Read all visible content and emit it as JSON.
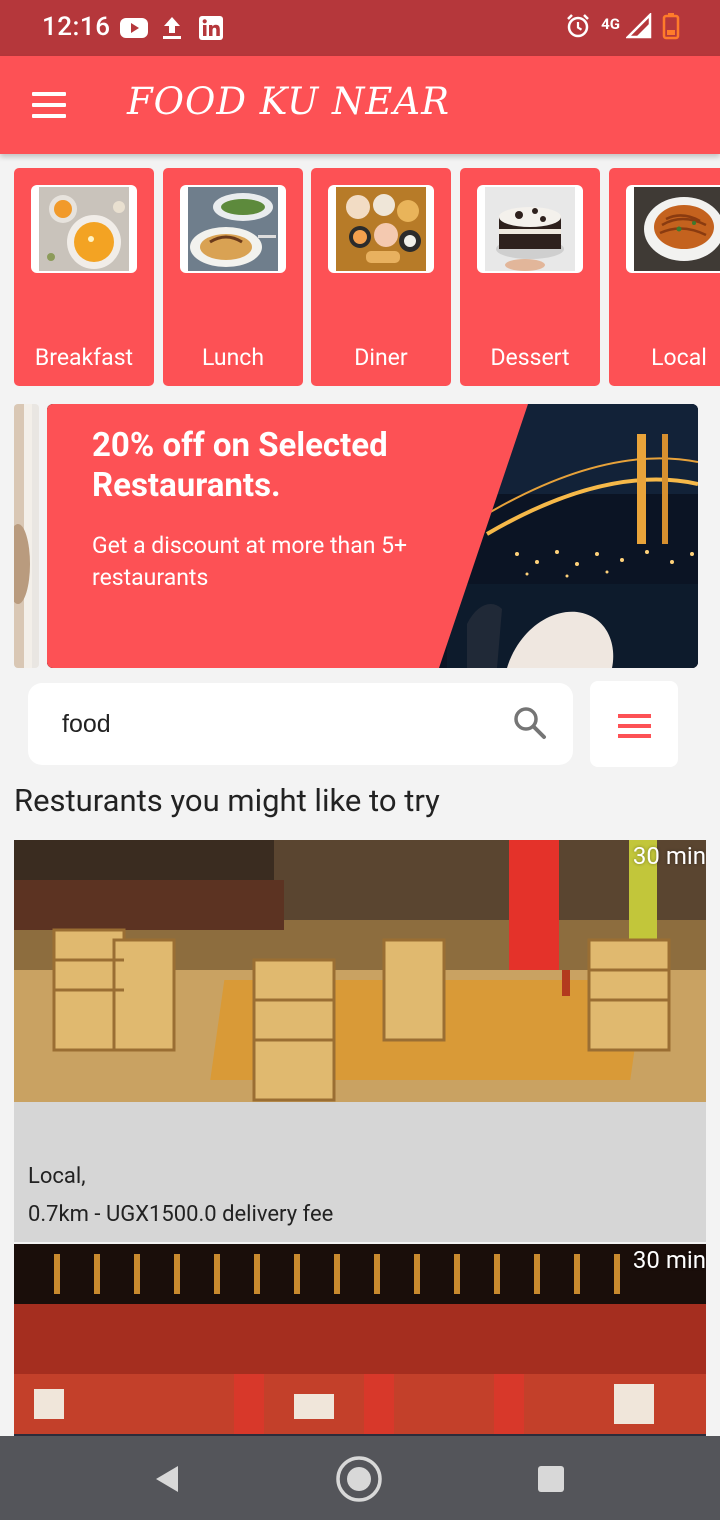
{
  "status_bar": {
    "time": "12:16",
    "network": "4G",
    "icons": [
      "youtube-icon",
      "upload-icon",
      "linkedin-icon",
      "alarm-icon",
      "signal-icon",
      "battery-low-icon"
    ]
  },
  "app_bar": {
    "title": "FOOD KU NEAR",
    "menu_icon": "menu-icon"
  },
  "categories": [
    {
      "label": "Breakfast",
      "icon": "soup-bowl-photo"
    },
    {
      "label": "Lunch",
      "icon": "pasta-plate-photo"
    },
    {
      "label": "Diner",
      "icon": "sushi-platter-photo"
    },
    {
      "label": "Dessert",
      "icon": "cake-photo"
    },
    {
      "label": "Local",
      "icon": "noodles-photo"
    }
  ],
  "banner": {
    "title": "20% off on Selected Restaurants.",
    "subtitle": "Get a discount at more than 5+ restaurants"
  },
  "search": {
    "value": "food",
    "icon": "search-icon",
    "filter_icon": "filter-menu-icon"
  },
  "section": {
    "title": "Resturants you might like to try"
  },
  "restaurants": [
    {
      "eta": "30 min",
      "cuisine": "Local,",
      "meta": "0.7km - UGX1500.0 delivery fee"
    },
    {
      "eta": "30 min",
      "cuisine": "",
      "meta": ""
    }
  ],
  "colors": {
    "primary": "#fd5155",
    "status_bar": "#b5373b",
    "card_background": "#d6d6d6",
    "nav_bar": "#54555a"
  }
}
